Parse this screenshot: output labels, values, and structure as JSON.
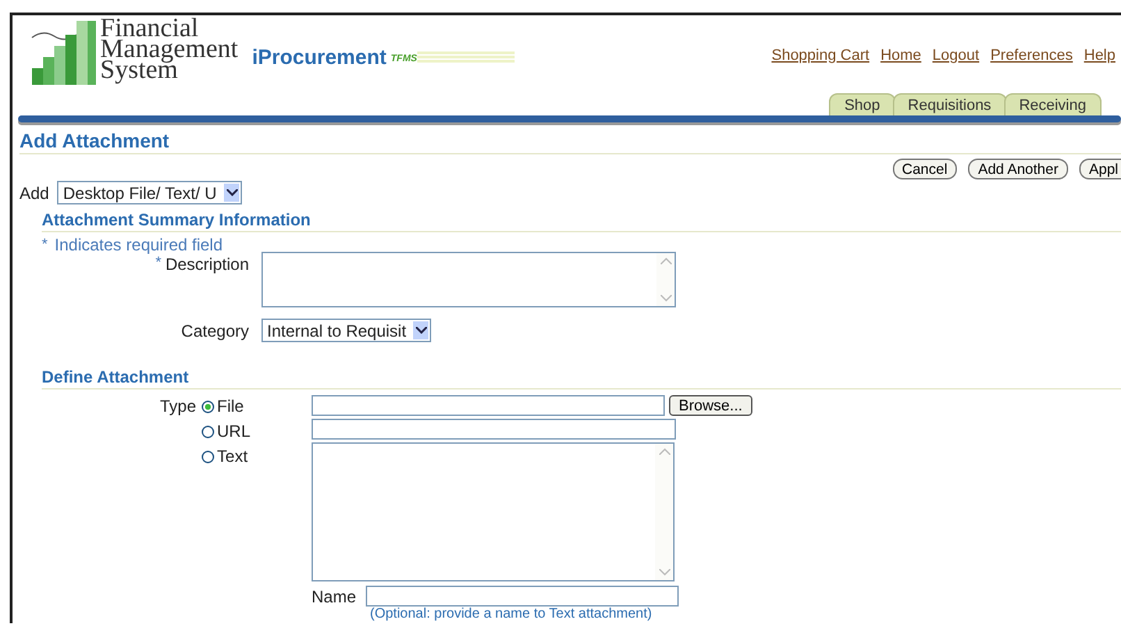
{
  "header": {
    "logo_text": [
      "Financial",
      "Management",
      "System"
    ],
    "app_name": "iProcurement",
    "app_tag": "TFMS"
  },
  "global_links": [
    "Shopping Cart",
    "Home",
    "Logout",
    "Preferences",
    "Help"
  ],
  "tabs": [
    {
      "label": "Shop",
      "selected": false
    },
    {
      "label": "Requisitions",
      "selected": false
    },
    {
      "label": "Receiving",
      "selected": false
    }
  ],
  "page_title": "Add Attachment",
  "buttons": [
    "Cancel",
    "Add Another",
    "Appl"
  ],
  "add": {
    "label": "Add",
    "value": "Desktop File/ Text/ U"
  },
  "summary": {
    "title": "Attachment Summary Information",
    "required_mark": "*",
    "required_note": "Indicates required field",
    "description_label": "Description",
    "description_required": true,
    "category_label": "Category",
    "category_value": "Internal to Requisit"
  },
  "define": {
    "title": "Define Attachment",
    "type_label": "Type",
    "options": [
      {
        "label": "File",
        "selected": true
      },
      {
        "label": "URL",
        "selected": false
      },
      {
        "label": "Text",
        "selected": false
      }
    ],
    "browse_button": "Browse...",
    "name_label": "Name",
    "name_hint": "(Optional: provide a name to Text attachment)"
  }
}
